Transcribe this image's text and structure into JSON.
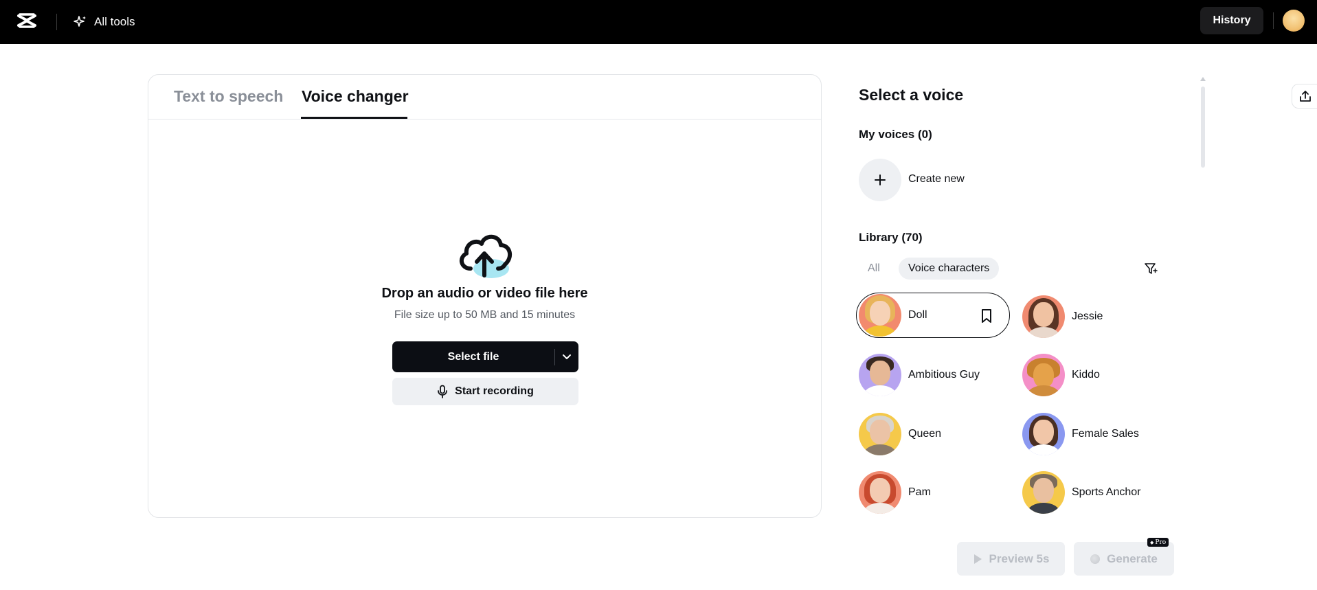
{
  "topbar": {
    "all_tools_label": "All tools",
    "history_label": "History"
  },
  "tabs": [
    {
      "label": "Text to speech",
      "active": false
    },
    {
      "label": "Voice changer",
      "active": true
    }
  ],
  "upload": {
    "title": "Drop an audio or video file here",
    "subtitle": "File size up to 50 MB and 15 minutes",
    "select_file_label": "Select file",
    "start_recording_label": "Start recording"
  },
  "panel": {
    "title": "Select a voice",
    "my_voices_label": "My voices (0)",
    "create_new_label": "Create new",
    "library_label": "Library (70)",
    "filters": [
      {
        "label": "All",
        "active": false
      },
      {
        "label": "Voice characters",
        "active": true
      }
    ],
    "voices": [
      {
        "name": "Doll",
        "selected": true,
        "bg": "#f28a6e"
      },
      {
        "name": "Jessie",
        "selected": false,
        "bg": "#f08a70"
      },
      {
        "name": "Ambitious Guy",
        "selected": false,
        "bg": "#b7a4f0"
      },
      {
        "name": "Kiddo",
        "selected": false,
        "bg": "#f48fc7"
      },
      {
        "name": "Queen",
        "selected": false,
        "bg": "#f5c94a"
      },
      {
        "name": "Female Sales",
        "selected": false,
        "bg": "#8a98f0"
      },
      {
        "name": "Pam",
        "selected": false,
        "bg": "#f08a70"
      },
      {
        "name": "Sports Anchor",
        "selected": false,
        "bg": "#f5c94a"
      }
    ]
  },
  "actions": {
    "preview_label": "Preview 5s",
    "generate_label": "Generate",
    "pro_badge": "Pro"
  },
  "colors": {
    "topbar_bg": "#000000",
    "primary_button": "#0c0e14",
    "disabled_text": "#b9bdc4",
    "upload_accent": "#a8e6f2"
  }
}
